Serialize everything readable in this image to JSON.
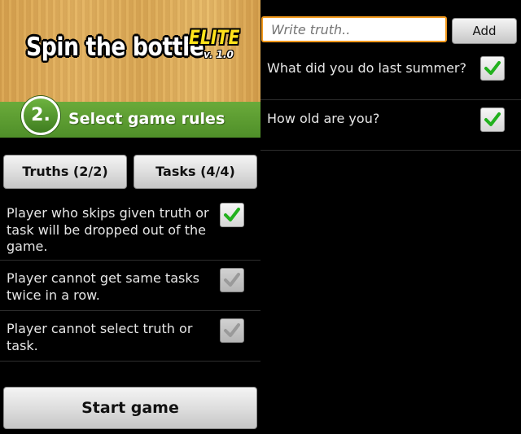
{
  "header": {
    "title": "Spin the bottle",
    "edition": "ELITE",
    "version": "v. 1.0"
  },
  "step": {
    "number": "2.",
    "label": "Select game rules"
  },
  "tabs": {
    "truths_label": "Truths (2/2)",
    "tasks_label": "Tasks (4/4)"
  },
  "rules": [
    {
      "text": "Player who skips given truth or task will be dropped out of the game.",
      "checked": true,
      "enabled": true
    },
    {
      "text": "Player cannot get same tasks twice in a row.",
      "checked": true,
      "enabled": false
    },
    {
      "text": "Player cannot select truth or task.",
      "checked": true,
      "enabled": false
    }
  ],
  "start_label": "Start game",
  "truth_entry": {
    "placeholder": "Write truth..",
    "value": "",
    "add_label": "Add"
  },
  "truths": [
    {
      "text": "What did you do last summer?",
      "checked": true
    },
    {
      "text": "How old are you?",
      "checked": true
    }
  ],
  "colors": {
    "accent_green": "#4f8f29",
    "input_focus": "#f39a1d",
    "edition_yellow": "#ffe31a",
    "check_green": "#22b11e",
    "check_gray": "#b5b5b5"
  }
}
